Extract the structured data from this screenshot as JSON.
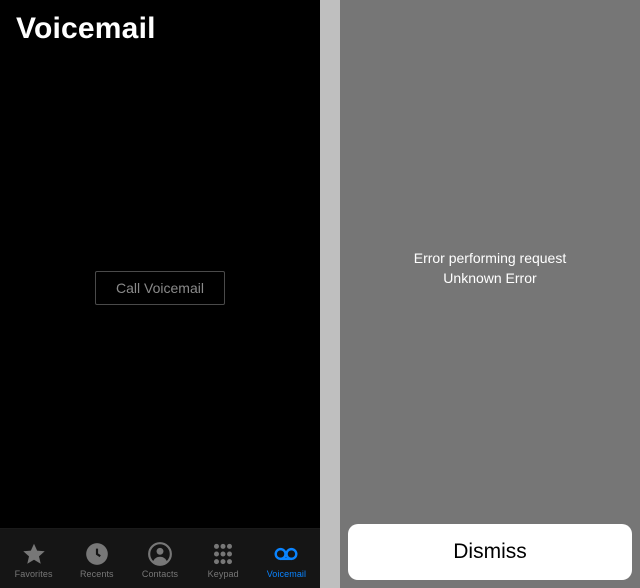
{
  "left": {
    "title": "Voicemail",
    "call_button_label": "Call Voicemail",
    "tabs": {
      "favorites": "Favorites",
      "recents": "Recents",
      "contacts": "Contacts",
      "keypad": "Keypad",
      "voicemail": "Voicemail"
    },
    "active_tab": "voicemail"
  },
  "right": {
    "error_line1": "Error performing request",
    "error_line2": "Unknown Error",
    "dismiss_label": "Dismiss"
  },
  "colors": {
    "accent": "#0a84ff",
    "inactive": "#777777",
    "right_bg": "#767676"
  }
}
